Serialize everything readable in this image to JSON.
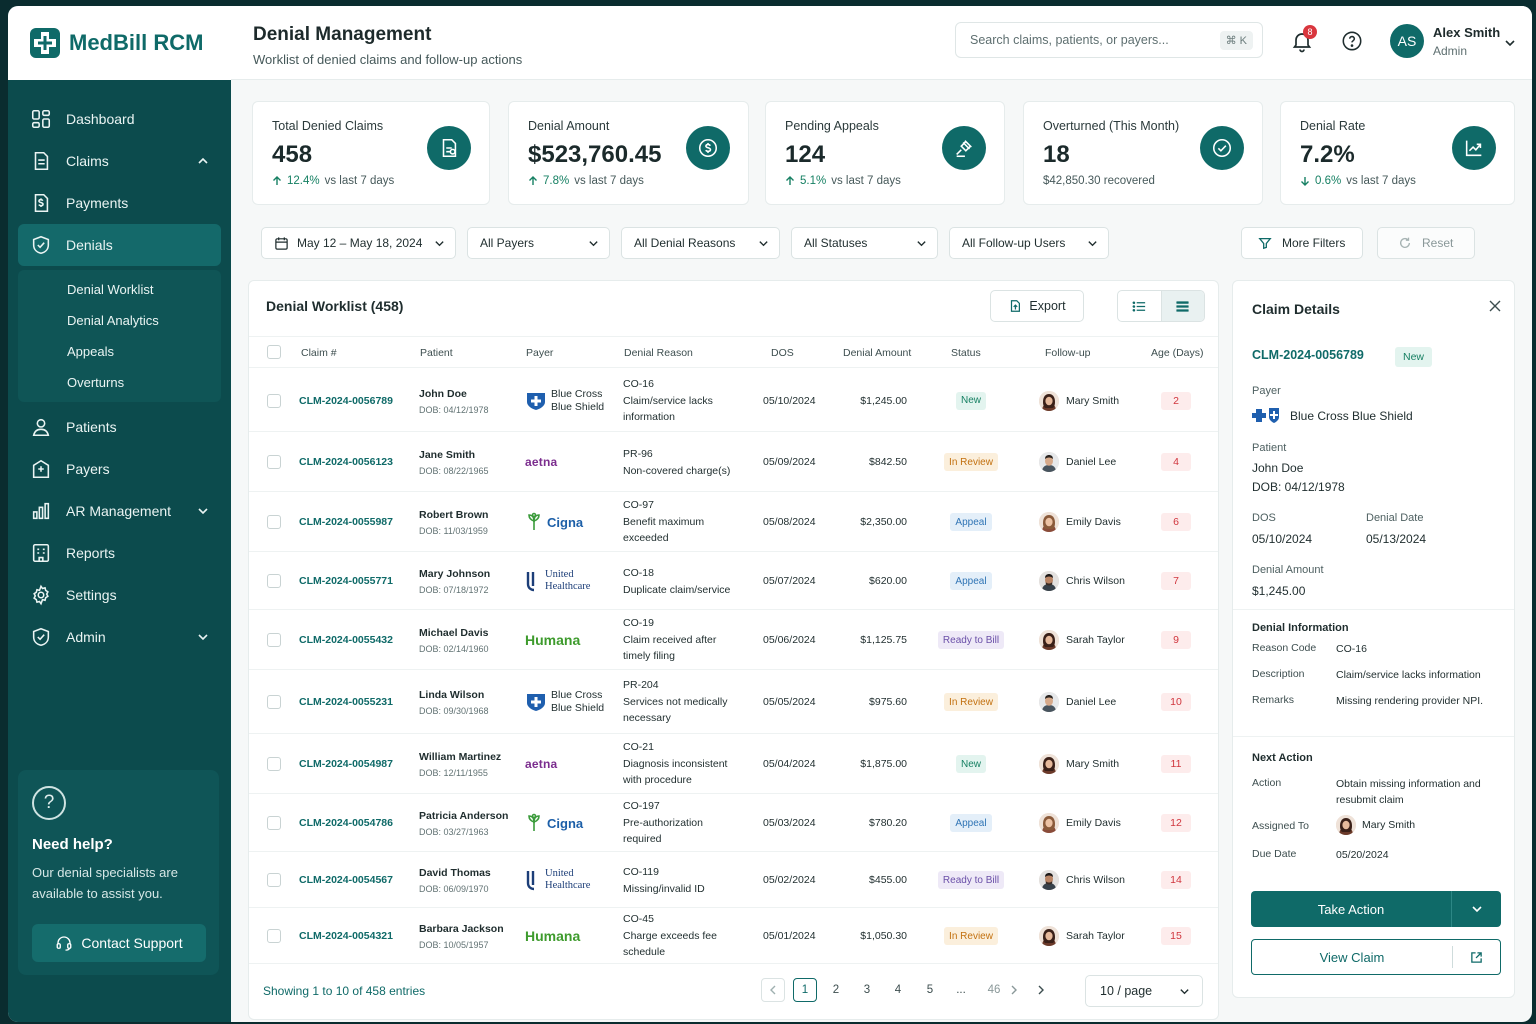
{
  "app": {
    "name": "MedBill RCM"
  },
  "sidebar": {
    "items": [
      {
        "label": "Dashboard"
      },
      {
        "label": "Claims"
      },
      {
        "label": "Payments"
      },
      {
        "label": "Denials"
      },
      {
        "label": "Patients"
      },
      {
        "label": "Payers"
      },
      {
        "label": "AR Management"
      },
      {
        "label": "Reports"
      },
      {
        "label": "Settings"
      },
      {
        "label": "Admin"
      }
    ],
    "denial_sub": [
      "Denial Worklist",
      "Denial Analytics",
      "Appeals",
      "Overturns"
    ],
    "help": {
      "title": "Need help?",
      "text": "Our denial specialists are available to assist you.",
      "button": "Contact Support"
    }
  },
  "header": {
    "title": "Denial Management",
    "subtitle": "Worklist of denied claims and follow-up actions",
    "search_placeholder": "Search claims, patients, or payers...",
    "search_shortcut": "⌘ K",
    "notifications": "8",
    "user": {
      "initials": "AS",
      "name": "Alex Smith",
      "role": "Admin"
    }
  },
  "stats": [
    {
      "label": "Total Denied Claims",
      "value": "458",
      "pct": "12.4%",
      "suffix": "vs last 7 days",
      "trend": "up"
    },
    {
      "label": "Denial Amount",
      "value": "$523,760.45",
      "pct": "7.8%",
      "suffix": "vs last 7 days",
      "trend": "up"
    },
    {
      "label": "Pending Appeals",
      "value": "124",
      "pct": "5.1%",
      "suffix": "vs last 7 days",
      "trend": "up"
    },
    {
      "label": "Overturned (This Month)",
      "value": "18",
      "pct": "",
      "suffix": "$42,850.30 recovered",
      "trend": "none"
    },
    {
      "label": "Denial Rate",
      "value": "7.2%",
      "pct": "0.6%",
      "suffix": "vs last 7 days",
      "trend": "down"
    }
  ],
  "filters": {
    "date_range": "May 12 – May 18, 2024",
    "payers": "All Payers",
    "reasons": "All Denial Reasons",
    "statuses": "All Statuses",
    "users": "All Follow-up Users",
    "more": "More Filters",
    "reset": "Reset"
  },
  "worklist": {
    "title": "Denial Worklist (458)",
    "export": "Export",
    "columns": [
      "Claim #",
      "Patient",
      "Payer",
      "Denial Reason",
      "DOS",
      "Denial Amount",
      "Status",
      "Follow-up",
      "Age (Days)"
    ],
    "rows": [
      {
        "claim": "CLM-2024-0056789",
        "patient": "John Doe",
        "dob": "DOB: 04/12/1978",
        "payer": "Blue Cross Blue Shield",
        "payer_lines": [
          "Blue Cross",
          "Blue Shield"
        ],
        "payer_logo": "bcbs",
        "code": "CO-16",
        "reason": "Claim/service lacks information",
        "dos": "05/10/2024",
        "amount": "$1,245.00",
        "status": "New",
        "status_kind": "new",
        "followup": "Mary Smith",
        "face": "f",
        "age": "2"
      },
      {
        "claim": "CLM-2024-0056123",
        "patient": "Jane Smith",
        "dob": "DOB: 08/22/1965",
        "payer": "aetna",
        "payer_lines": [
          "aetna"
        ],
        "payer_logo": "aetna",
        "code": "PR-96",
        "reason": "Non-covered charge(s)",
        "dos": "05/09/2024",
        "amount": "$842.50",
        "status": "In Review",
        "status_kind": "review",
        "followup": "Daniel Lee",
        "face": "m",
        "age": "4"
      },
      {
        "claim": "CLM-2024-0055987",
        "patient": "Robert Brown",
        "dob": "DOB: 11/03/1959",
        "payer": "Cigna",
        "payer_lines": [
          "Cigna"
        ],
        "payer_logo": "cigna",
        "code": "CO-97",
        "reason": "Benefit maximum exceeded",
        "dos": "05/08/2024",
        "amount": "$2,350.00",
        "status": "Appeal",
        "status_kind": "appeal",
        "followup": "Emily Davis",
        "face": "f2",
        "age": "6"
      },
      {
        "claim": "CLM-2024-0055771",
        "patient": "Mary Johnson",
        "dob": "DOB: 07/18/1972",
        "payer": "United Healthcare",
        "payer_lines": [
          "United",
          "Healthcare"
        ],
        "payer_logo": "uhc",
        "code": "CO-18",
        "reason": "Duplicate claim/service",
        "dos": "05/07/2024",
        "amount": "$620.00",
        "status": "Appeal",
        "status_kind": "appeal",
        "followup": "Chris Wilson",
        "face": "m2",
        "age": "7"
      },
      {
        "claim": "CLM-2024-0055432",
        "patient": "Michael Davis",
        "dob": "DOB: 02/14/1960",
        "payer": "Humana",
        "payer_lines": [
          "Humana"
        ],
        "payer_logo": "humana",
        "code": "CO-19",
        "reason": "Claim received after timely filing",
        "dos": "05/06/2024",
        "amount": "$1,125.75",
        "status": "Ready to Bill",
        "status_kind": "ready",
        "followup": "Sarah Taylor",
        "face": "f",
        "age": "9"
      },
      {
        "claim": "CLM-2024-0055231",
        "patient": "Linda Wilson",
        "dob": "DOB: 09/30/1968",
        "payer": "Blue Cross Blue Shield",
        "payer_lines": [
          "Blue Cross",
          "Blue Shield"
        ],
        "payer_logo": "bcbs",
        "code": "PR-204",
        "reason": "Services not medically necessary",
        "dos": "05/05/2024",
        "amount": "$975.60",
        "status": "In Review",
        "status_kind": "review",
        "followup": "Daniel Lee",
        "face": "m",
        "age": "10"
      },
      {
        "claim": "CLM-2024-0054987",
        "patient": "William Martinez",
        "dob": "DOB: 12/11/1955",
        "payer": "aetna",
        "payer_lines": [
          "aetna"
        ],
        "payer_logo": "aetna",
        "code": "CO-21",
        "reason": "Diagnosis inconsistent with procedure",
        "dos": "05/04/2024",
        "amount": "$1,875.00",
        "status": "New",
        "status_kind": "new",
        "followup": "Mary Smith",
        "face": "f",
        "age": "11"
      },
      {
        "claim": "CLM-2024-0054786",
        "patient": "Patricia Anderson",
        "dob": "DOB: 03/27/1963",
        "payer": "Cigna",
        "payer_lines": [
          "Cigna"
        ],
        "payer_logo": "cigna",
        "code": "CO-197",
        "reason": "Pre-authorization required",
        "dos": "05/03/2024",
        "amount": "$780.20",
        "status": "Appeal",
        "status_kind": "appeal",
        "followup": "Emily Davis",
        "face": "f2",
        "age": "12"
      },
      {
        "claim": "CLM-2024-0054567",
        "patient": "David Thomas",
        "dob": "DOB: 06/09/1970",
        "payer": "United Healthcare",
        "payer_lines": [
          "United",
          "Healthcare"
        ],
        "payer_logo": "uhc",
        "code": "CO-119",
        "reason": "Missing/invalid ID",
        "dos": "05/02/2024",
        "amount": "$455.00",
        "status": "Ready to Bill",
        "status_kind": "ready",
        "followup": "Chris Wilson",
        "face": "m2",
        "age": "14"
      },
      {
        "claim": "CLM-2024-0054321",
        "patient": "Barbara Jackson",
        "dob": "DOB: 10/05/1957",
        "payer": "Humana",
        "payer_lines": [
          "Humana"
        ],
        "payer_logo": "humana",
        "code": "CO-45",
        "reason": "Charge exceeds fee schedule",
        "dos": "05/01/2024",
        "amount": "$1,050.30",
        "status": "In Review",
        "status_kind": "review",
        "followup": "Sarah Taylor",
        "face": "f",
        "age": "15"
      }
    ],
    "footer": "Showing 1 to 10 of 458 entries",
    "pages": [
      "1",
      "2",
      "3",
      "4",
      "5",
      "...",
      "46"
    ],
    "current_page": "1",
    "per_page": "10 / page"
  },
  "details": {
    "title": "Claim Details",
    "claim": "CLM-2024-0056789",
    "status": "New",
    "payer_label": "Payer",
    "payer": "Blue Cross Blue Shield",
    "patient_label": "Patient",
    "patient": "John Doe",
    "dob": "DOB: 04/12/1978",
    "dos_label": "DOS",
    "dos": "05/10/2024",
    "denial_date_label": "Denial Date",
    "denial_date": "05/13/2024",
    "amount_label": "Denial Amount",
    "amount": "$1,245.00",
    "denial_info_title": "Denial Information",
    "reason_code_label": "Reason Code",
    "reason_code": "CO-16",
    "description_label": "Description",
    "description": "Claim/service lacks information",
    "remarks_label": "Remarks",
    "remarks": "Missing rendering provider NPI.",
    "next_action_title": "Next Action",
    "action_label": "Action",
    "action": "Obtain missing information and resubmit claim",
    "assigned_label": "Assigned To",
    "assigned": "Mary Smith",
    "due_label": "Due Date",
    "due": "05/20/2024",
    "take_action": "Take Action",
    "view_claim": "View Claim"
  }
}
